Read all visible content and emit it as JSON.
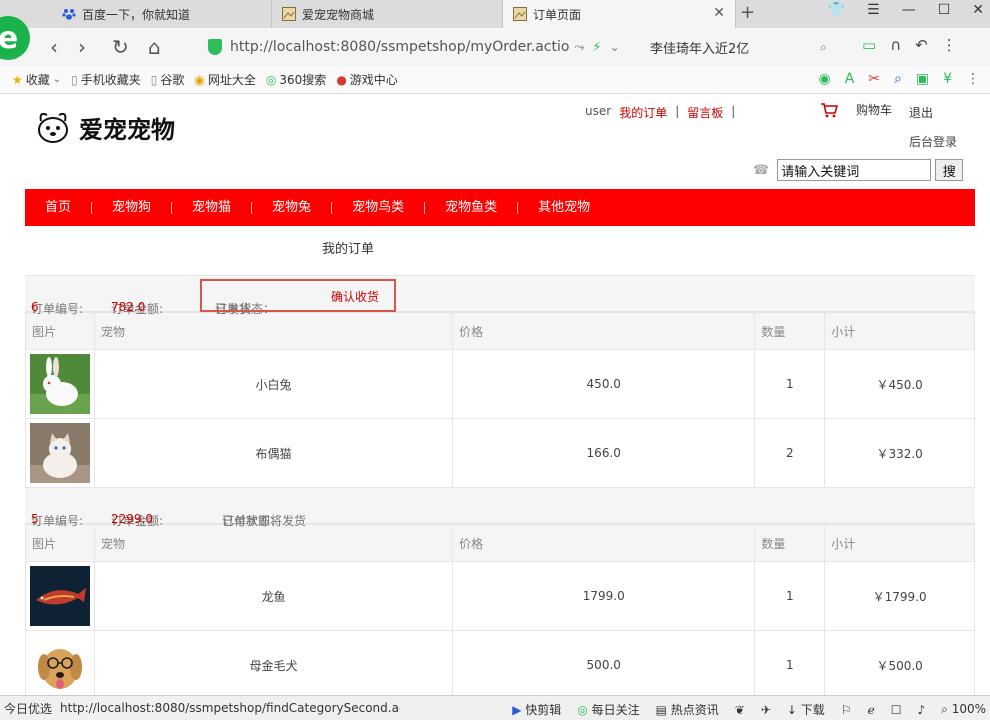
{
  "browser": {
    "tabs": [
      {
        "title": "百度一下，你就知道"
      },
      {
        "title": "爱宠宠物商城"
      },
      {
        "title": "订单页面"
      }
    ],
    "url": "http://localhost:8080/ssmpetshop/myOrder.action",
    "search_query": "李佳琦年入近2亿",
    "favorites": [
      "收藏",
      "手机收藏夹",
      "谷歌",
      "网址大全",
      "360搜索",
      "游戏中心"
    ],
    "status_url": "http://localhost:8080/ssmpetshop/findCategorySecond.act",
    "status_items": [
      "今日优选",
      "快剪辑",
      "每日关注",
      "热点资讯",
      "下载",
      "100%"
    ]
  },
  "site": {
    "logo": "爱宠宠物",
    "user": "user",
    "my_orders": "我的订单",
    "guestbook": "留言板",
    "separator": "|",
    "cart": "购物车",
    "logout": "退出",
    "admin": "后台登录",
    "search_value": "请输入关键词",
    "search_button": "搜",
    "menu": [
      "首页",
      "宠物狗",
      "宠物猫",
      "宠物兔",
      "宠物鸟类",
      "宠物鱼类",
      "其他宠物"
    ],
    "page_title": "我的订单"
  },
  "labels": {
    "order_no": "订单编号:",
    "order_total": "订单金额:",
    "order_status": "订单状态：",
    "col_image": "图片",
    "col_pet": "宠物",
    "col_price": "价格",
    "col_qty": "数量",
    "col_subtotal": "小计"
  },
  "orders": [
    {
      "no": "6",
      "total": "782.0",
      "status": "已发货",
      "action": "确认收货",
      "items": [
        {
          "name": "小白兔",
          "price": "450.0",
          "qty": "1",
          "subtotal": "￥450.0",
          "image": "white-rabbit"
        },
        {
          "name": "布偶猫",
          "price": "166.0",
          "qty": "2",
          "subtotal": "￥332.0",
          "image": "ragdoll-cat"
        }
      ]
    },
    {
      "no": "5",
      "total": "2299.0",
      "status": "已付款即将发货",
      "items": [
        {
          "name": "龙鱼",
          "price": "1799.0",
          "qty": "1",
          "subtotal": "￥1799.0",
          "image": "arowana-fish"
        },
        {
          "name": "母金毛犬",
          "price": "500.0",
          "qty": "1",
          "subtotal": "￥500.0",
          "image": "golden-retriever"
        }
      ]
    }
  ],
  "colors": {
    "menu_bg": "#ff0000",
    "accent": "#cc0000",
    "highlight_box": "#d9534f"
  }
}
